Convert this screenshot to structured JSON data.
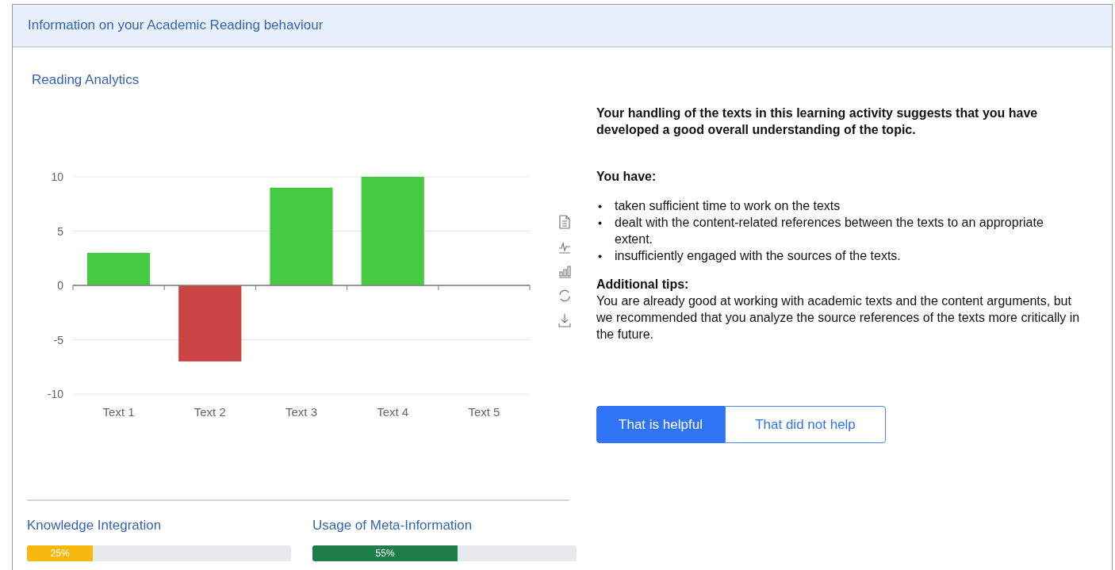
{
  "panel": {
    "title": "Information on your Academic Reading behaviour"
  },
  "analytics": {
    "title": "Reading Analytics",
    "chart_data": {
      "type": "bar",
      "categories": [
        "Text 1",
        "Text 2",
        "Text 3",
        "Text 4",
        "Text 5"
      ],
      "series": [
        {
          "color": "#48c944",
          "values": [
            3,
            null,
            9,
            10,
            0
          ]
        },
        {
          "color": "#cc4444",
          "values": [
            null,
            -7,
            null,
            null,
            null
          ]
        }
      ],
      "stacked": true,
      "ylim": [
        -10,
        10
      ],
      "yticks": [
        -10,
        -5,
        0,
        5,
        10
      ]
    },
    "toolbar": [
      {
        "kind": "document"
      },
      {
        "kind": "line"
      },
      {
        "kind": "bars"
      },
      {
        "kind": "refresh"
      },
      {
        "kind": "download"
      }
    ]
  },
  "feedback": {
    "summary": "Your handling of the texts in this learning activity suggests that you have developed a good overall understanding of the topic.",
    "list_heading": "You have:",
    "points": [
      "taken sufficient time to work on the texts",
      "dealt with the content-related references between the texts to an appropriate extent.",
      "insufficiently engaged with the sources of the texts."
    ],
    "tips_heading": "Additional tips:",
    "tips": "You are already good at working with academic texts and the content arguments, but we recommended that you analyze the source references of the texts more critically in the future.",
    "buttons": [
      {
        "label": "That is helpful",
        "selected": true
      },
      {
        "label": "That did not help",
        "selected": false
      }
    ]
  },
  "metrics": [
    {
      "title": "Knowledge Integration",
      "level": 0.25,
      "reading": "25%",
      "color": "#f7b90f"
    },
    {
      "title": "Usage of Meta-Information",
      "level": 0.55,
      "reading": "55%",
      "color": "#1e7e4a"
    }
  ]
}
